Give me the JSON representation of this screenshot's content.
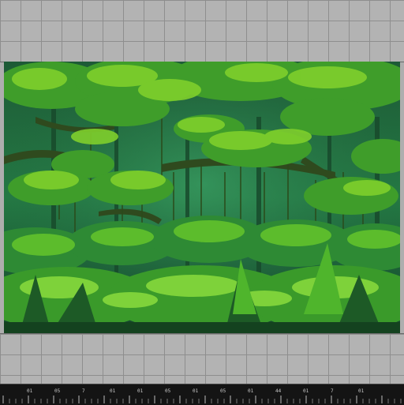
{
  "canvas": {
    "scene": "jungle-canopy-pixel-art",
    "colors": {
      "deep": "#12412a",
      "mid": "#1f6b3a",
      "foliage": "#3f9d2a",
      "highlight": "#8fdc3a",
      "vine": "#2a4a1a"
    }
  },
  "ruler": {
    "labels": [
      "01",
      "05",
      "7",
      "01",
      "01",
      "05",
      "01",
      "05",
      "01",
      "44",
      "01",
      "7",
      "01"
    ]
  }
}
